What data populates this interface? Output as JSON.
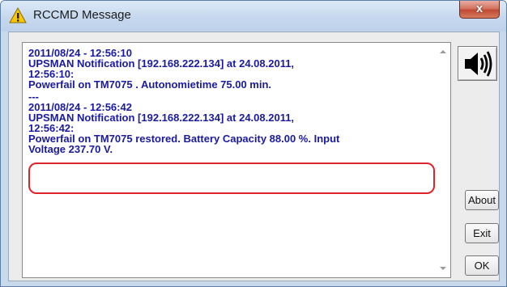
{
  "window": {
    "title": "RCCMD Message",
    "close_label": "x",
    "highlight_color": "#e0222a",
    "text_color": "#1a1aa0"
  },
  "messages": [
    {
      "lines": [
        "2011/08/24 - 12:56:10",
        "UPSMAN Notification [192.168.222.134] at 24.08.2011,",
        "12:56:10:",
        "Powerfail on TM7075 . Autonomietime 75.00 min."
      ]
    },
    {
      "lines": [
        "---"
      ]
    },
    {
      "lines": [
        "2011/08/24 - 12:56:42",
        "UPSMAN Notification [192.168.222.134] at 24.08.2011,",
        "12:56:42:",
        "Powerfail on TM7075 restored. Battery Capacity 88.00 %. Input",
        "Voltage 237.70 V."
      ]
    }
  ],
  "buttons": {
    "about": "About",
    "exit": "Exit",
    "ok": "OK"
  },
  "icons": {
    "title_icon": "warning-icon",
    "sound_icon": "speaker-icon"
  }
}
